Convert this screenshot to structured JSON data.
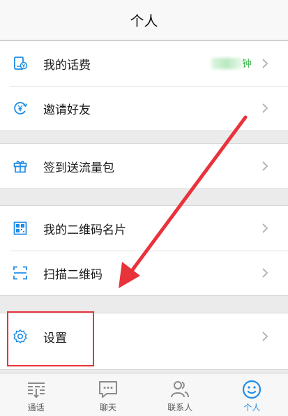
{
  "header": {
    "title": "个人"
  },
  "groups": {
    "account": {
      "items": [
        {
          "label": "我的话费",
          "value": "钟"
        },
        {
          "label": "邀请好友"
        }
      ]
    },
    "traffic": {
      "items": [
        {
          "label": "签到送流量包"
        }
      ]
    },
    "qr": {
      "items": [
        {
          "label": "我的二维码名片"
        },
        {
          "label": "扫描二维码"
        }
      ]
    },
    "settings": {
      "items": [
        {
          "label": "设置"
        }
      ]
    }
  },
  "tabbar": {
    "tabs": [
      {
        "label": "通话"
      },
      {
        "label": "聊天"
      },
      {
        "label": "联系人"
      },
      {
        "label": "个人"
      }
    ]
  },
  "colors": {
    "accent": "#1f8ce6",
    "annotation": "#e8333b",
    "value_text": "#3bb24a"
  }
}
